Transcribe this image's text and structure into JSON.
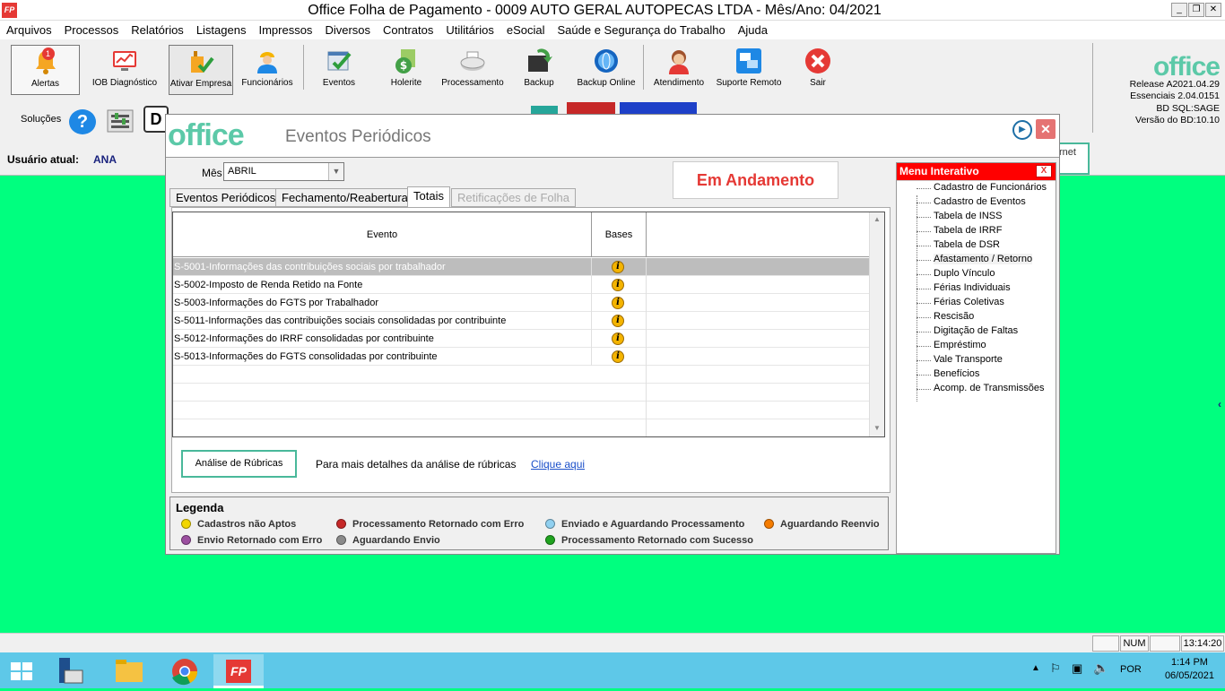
{
  "window": {
    "icon_text": "FP",
    "title": "Office Folha de Pagamento - 0009 AUTO GERAL AUTOPECAS LTDA - Mês/Ano: 04/2021",
    "min": "_",
    "max": "❐",
    "close": "✕"
  },
  "menu": [
    "Arquivos",
    "Processos",
    "Relatórios",
    "Listagens",
    "Impressos",
    "Diversos",
    "Contratos",
    "Utilitários",
    "eSocial",
    "Saúde e Segurança do Trabalho",
    "Ajuda"
  ],
  "toolbar": {
    "alertas": {
      "label": "Alertas",
      "badge": "1"
    },
    "iob": "IOB Diagnóstico",
    "ativar": "Ativar Empresa",
    "funcionarios": "Funcionários",
    "eventos": "Eventos",
    "holerite": "Holerite",
    "processamento": "Processamento",
    "backup": "Backup",
    "backup_online": "Backup Online",
    "atendimento": "Atendimento",
    "suporte": "Suporte Remoto",
    "sair": "Sair"
  },
  "brand": {
    "logo": "office",
    "release": "Release A2021.04.29",
    "essenciais": "Essenciais 2.04.0151",
    "bd": "BD SQL:SAGE",
    "versao": "Versão do BD:10.10"
  },
  "solucoes": "Soluções",
  "usuario": {
    "label": "Usuário atual:",
    "value": "ANA"
  },
  "hidden_peek": {
    "right_text": "rnet"
  },
  "dialog": {
    "logo": "office",
    "title": "Eventos Periódicos",
    "mes_label": "Mês",
    "mes_value": "ABRIL",
    "status": "Em Andamento",
    "tabs": [
      "Eventos Periódicos",
      "Fechamento/Reabertura",
      "Totais",
      "Retificações de Folha"
    ],
    "grid": {
      "headers": {
        "evento": "Evento",
        "bases": "Bases"
      },
      "rows": [
        "S-5001-Informações das contribuições sociais por trabalhador",
        "S-5002-Imposto de Renda Retido na Fonte",
        "S-5003-Informações do FGTS por Trabalhador",
        "S-5011-Informações das contribuições sociais consolidadas por contribuinte",
        "S-5012-Informações do IRRF consolidadas por contribuinte",
        "S-5013-Informações do FGTS consolidadas por contribuinte"
      ],
      "info_glyph": "i",
      "selected_row": 0
    },
    "analise_button": "Análise de Rúbricas",
    "analise_text": "Para mais detalhes da análise de rúbricas",
    "analise_link": "Clique aqui",
    "legenda": {
      "title": "Legenda",
      "items": [
        {
          "label": "Cadastros não Aptos",
          "color": "#f2d600"
        },
        {
          "label": "Processamento Retornado com Erro",
          "color": "#c62828"
        },
        {
          "label": "Enviado e Aguardando Processamento",
          "color": "#90d0f0"
        },
        {
          "label": "Aguardando Reenvio",
          "color": "#f57c00"
        },
        {
          "label": "Envio Retornado com Erro",
          "color": "#9c4fa0"
        },
        {
          "label": "Aguardando Envio",
          "color": "#8a8a8a"
        },
        {
          "label": "Processamento Retornado com Sucesso",
          "color": "#1fa31f"
        }
      ]
    },
    "menu_interativo": {
      "title": "Menu Interativo",
      "close": "X",
      "items": [
        "Cadastro de Funcionários",
        "Cadastro de Eventos",
        "Tabela de INSS",
        "Tabela de IRRF",
        "Tabela de DSR",
        "Afastamento / Retorno",
        "Duplo Vínculo",
        "Férias Individuais",
        "Férias Coletivas",
        "Rescisão",
        "Digitação de Faltas",
        "Empréstimo",
        "Vale Transporte",
        "Benefícios",
        "Acomp. de Transmissões"
      ]
    }
  },
  "statusbar": {
    "num": "NUM",
    "time": "13:14:20"
  },
  "taskbar": {
    "lang": "POR",
    "clock_time": "1:14 PM",
    "clock_date": "06/05/2021",
    "fp_label": "FP"
  }
}
